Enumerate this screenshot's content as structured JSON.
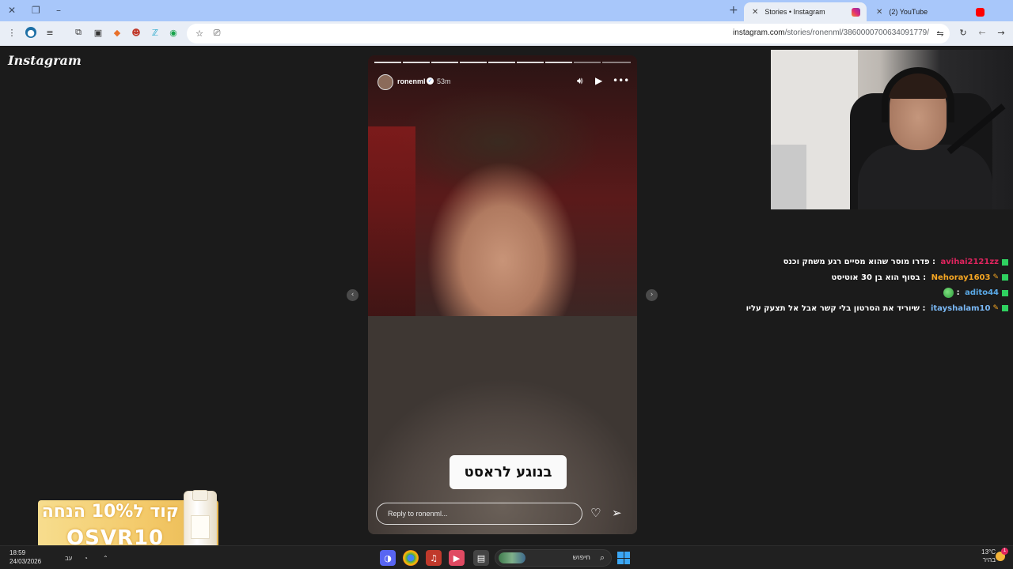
{
  "browser": {
    "tabs": [
      {
        "title": "Stories • Instagram",
        "active": true
      },
      {
        "title": "(2) YouTube",
        "active": false
      }
    ],
    "url_domain": "instagram.com",
    "url_path": "/stories/ronenml/3860000700634091779/"
  },
  "page": {
    "logo": "Instagram"
  },
  "story": {
    "username": "ronenml",
    "time": "53m",
    "caption": "בנוגע לראסט",
    "reply_placeholder": "Reply to ronenml..."
  },
  "chat": [
    {
      "user": "avihai2121zz",
      "user_color": "#e0245e",
      "message": "פדרו מוסר שהוא מסיים רגע משחק וכנס",
      "pen": false
    },
    {
      "user": "Nehoray1603",
      "user_color": "#f5a623",
      "message": "בסוף הוא בן 30 אוטיסט",
      "pen": true
    },
    {
      "user": "adito44",
      "user_color": "#5aa9e6",
      "message": "",
      "pen": false,
      "emote": "earth-emote"
    },
    {
      "user": "itayshalam10",
      "user_color": "#7ab8f5",
      "message": "שיוריד את הסרטון בלי קשר אבל אל תצעק עליו",
      "pen": true
    }
  ],
  "ad": {
    "line1": "קוד ל10% הנחה",
    "line2": "OSVR10"
  },
  "taskbar": {
    "time": "18:59",
    "date": "24/03/2026",
    "search_label": "חיפוש",
    "temperature": "13°C",
    "weather_text": "בהיר",
    "notification_count": "1"
  },
  "colors": {
    "tabstrip": "#a8c7fa",
    "toolbar": "#e9eef6",
    "page_bg": "#1b1b1b",
    "chat_badge": "#2fd160"
  }
}
